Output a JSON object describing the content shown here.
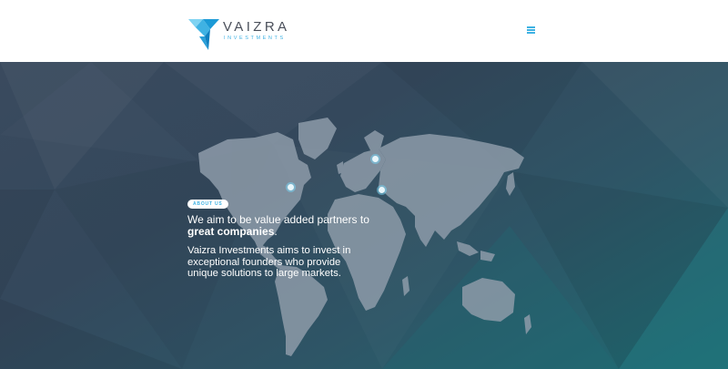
{
  "brand": {
    "name": "VAIZRA",
    "tagline": "INVESTMENTS",
    "accent_color": "#3fb2e3",
    "logo_icon": "arrow-triangle-logo"
  },
  "header": {
    "menu_icon": "hamburger-menu-icon"
  },
  "hero": {
    "badge": "ABOUT US",
    "headline_prefix": "We aim to be value added partners to ",
    "headline_bold": "great companies",
    "headline_suffix": ".",
    "body": "Vaizra Investments aims to invest in exceptional founders who provide unique solutions to large markets.",
    "map_markers": [
      {
        "name": "north-america-east-marker"
      },
      {
        "name": "northern-europe-marker"
      },
      {
        "name": "middle-east-marker"
      }
    ]
  }
}
